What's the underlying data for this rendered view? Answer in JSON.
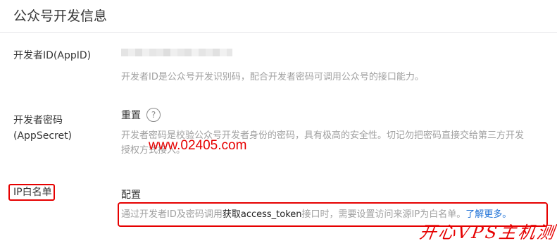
{
  "page_title": "公众号开发信息",
  "appid": {
    "label": "开发者ID(AppID)",
    "masked": true,
    "description": "开发者ID是公众号开发识别码，配合开发者密码可调用公众号的接口能力。"
  },
  "appsecret": {
    "label_line1": "开发者密码",
    "label_line2": "(AppSecret)",
    "action": "重置",
    "help_icon": "question-circle-icon",
    "description_line1": "开发者密码是校验公众号开发者身份的密码，具有极高的安全性。切记勿把密码直接交给第三方开发",
    "description_line2": "授权方式接入。"
  },
  "watermark": "www.02405.com",
  "ip_whitelist": {
    "label": "IP白名单",
    "action": "配置",
    "description_prefix": "通过开发者ID及密码调用",
    "description_highlight": "获取access_token",
    "description_suffix": "接口时，需要设置访问来源IP为白名单。",
    "learn_more": "了解更多。"
  },
  "brand_mark": "开心VPS主机测评",
  "colors": {
    "annotation_red": "#e60000",
    "link_blue": "#1b6fd6",
    "muted_text": "#a0a0a0"
  }
}
